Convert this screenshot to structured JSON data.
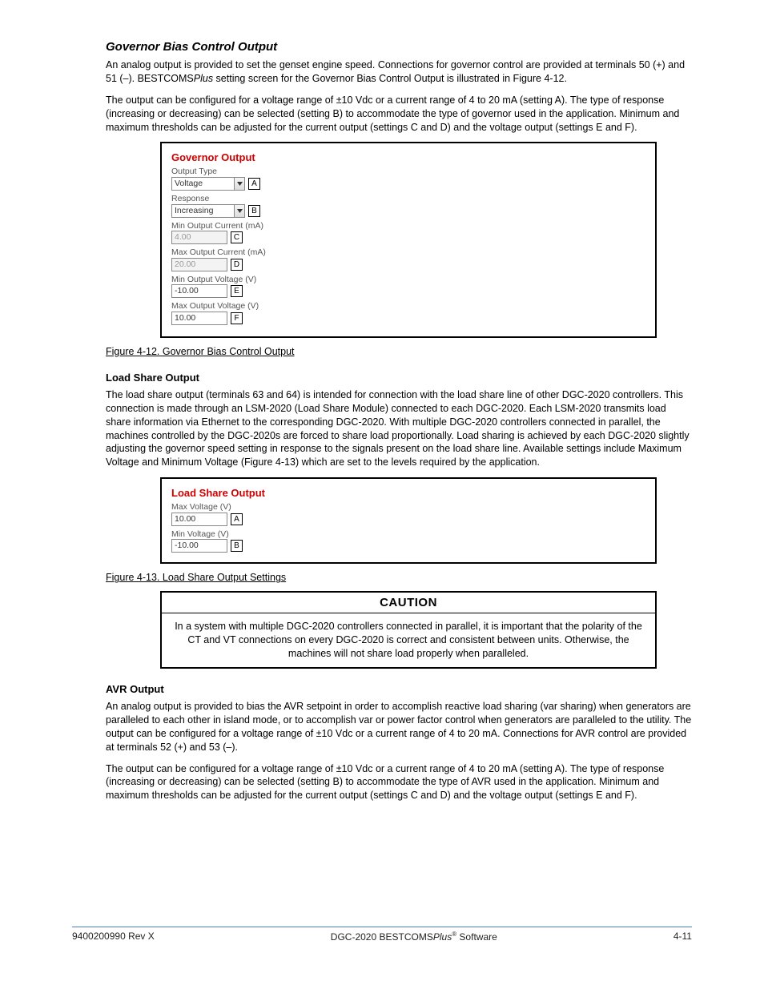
{
  "intro": {
    "para1": "An analog output is provided to set the genset engine speed. Connections for governor control are provided at terminals 50 (+) and 51 (–). BESTCOMS",
    "para1_italic": "Plus",
    "para1_cont": " setting screen for the Governor Bias Control Output is illustrated in Figure 4-12.",
    "para2": "The output can be configured for a voltage range of ±10 Vdc or a current range of 4 to 20 mA (setting A). The type of response (increasing or decreasing) can be selected (setting B) to accommodate the type of governor used in the application. Minimum and maximum thresholds can be adjusted for the current output (settings C and D) and the voltage output (settings E and F)."
  },
  "governor_panel": {
    "title": "Governor Output",
    "fields": {
      "output_type": {
        "label": "Output Type",
        "value": "Voltage",
        "letter": "A"
      },
      "response": {
        "label": "Response",
        "value": "Increasing",
        "letter": "B"
      },
      "min_current": {
        "label": "Min Output Current (mA)",
        "value": "4.00",
        "letter": "C",
        "disabled": true
      },
      "max_current": {
        "label": "Max Output Current (mA)",
        "value": "20.00",
        "letter": "D",
        "disabled": true
      },
      "min_voltage": {
        "label": "Min Output Voltage (V)",
        "value": "-10.00",
        "letter": "E"
      },
      "max_voltage": {
        "label": "Max Output Voltage (V)",
        "value": "10.00",
        "letter": "F"
      }
    }
  },
  "fig12_caption": "Figure 4-12. Governor Bias Control Output",
  "loadshare_heading": "Load Share Output",
  "loadshare_para_full": "The load share output (terminals 63 and 64) is intended for connection with the load share line of other DGC-2020 controllers. This connection is made through an LSM-2020 (Load Share Module) connected to each DGC-2020. Each LSM-2020 transmits load share information via Ethernet to the corresponding DGC-2020. With multiple DGC-2020 controllers connected in parallel, the machines controlled by the DGC-2020s are forced to share load proportionally. Load sharing is achieved by each DGC-2020 slightly adjusting the governor speed setting in response to the signals present on the load share line. Available settings include Maximum Voltage and Minimum Voltage (Figure 4-13) which are set to the levels required by the application.",
  "loadshare_panel": {
    "title": "Load Share Output",
    "fields": {
      "max_voltage": {
        "label": "Max Voltage (V)",
        "value": "10.00",
        "letter": "A"
      },
      "min_voltage": {
        "label": "Min Voltage (V)",
        "value": "-10.00",
        "letter": "B"
      }
    }
  },
  "fig13_caption": "Figure 4-13. Load Share Output Settings",
  "caution": {
    "head": "CAUTION",
    "body": "In a system with multiple DGC-2020 controllers connected in parallel, it is important that the polarity of the CT and VT connections on every DGC-2020 is correct and consistent between units. Otherwise, the machines will not share load properly when paralleled."
  },
  "avr_heading": "AVR Output",
  "avr_para_full": "An analog output is provided to bias the AVR setpoint in order to accomplish reactive load sharing (var sharing) when generators are paralleled to each other in island mode, or to accomplish var or power factor control when generators are paralleled to the utility. The output can be configured for a voltage range of ±10 Vdc or a current range of 4 to 20 mA. Connections for AVR control are provided at terminals 52 (+) and 53 (–).",
  "avr_para2": "The output can be configured for a voltage range of ±10 Vdc or a current range of 4 to 20 mA (setting A). The type of response (increasing or decreasing) can be selected (setting B) to accommodate the type of AVR used in the application. Minimum and maximum thresholds can be adjusted for the current output (settings C and D) and the voltage output (settings E and F).",
  "footer": {
    "left": "9400200990 Rev X",
    "center_prefix": "DGC-2020 BESTCOMS",
    "center_italic": "Plus",
    "center_suffix": " Software",
    "right": "4-11"
  }
}
